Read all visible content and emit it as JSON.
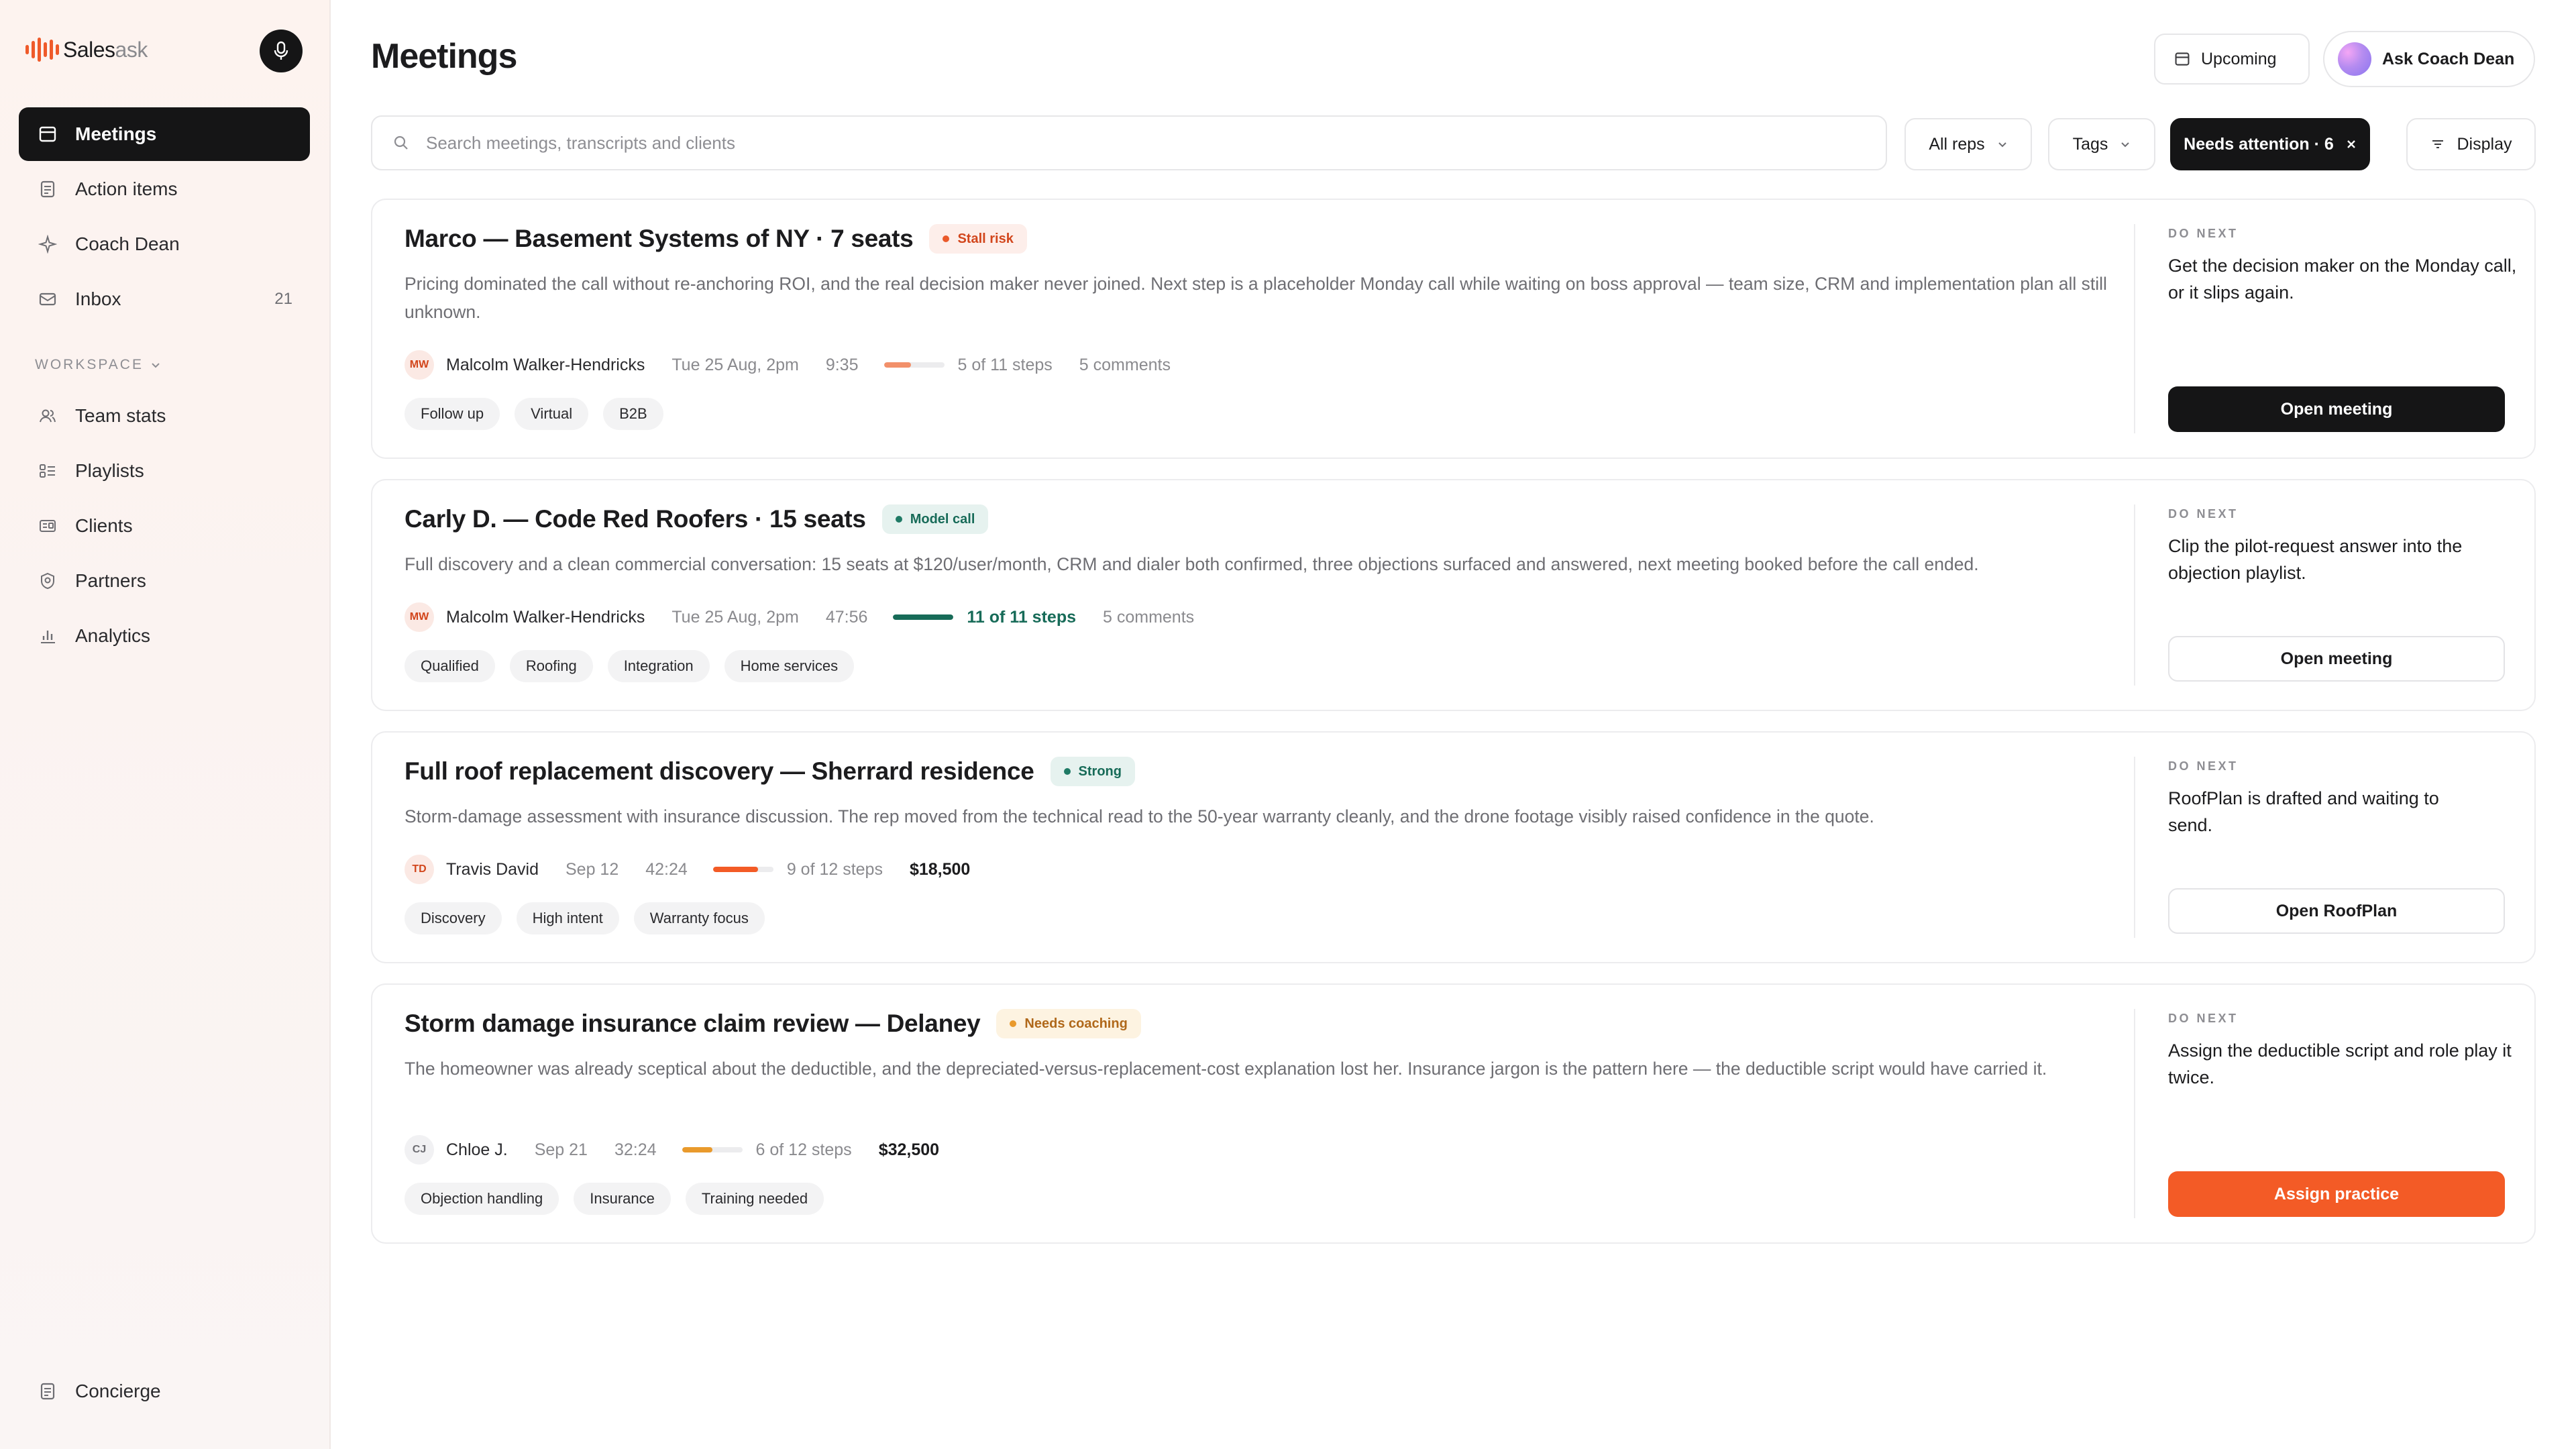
{
  "brand": {
    "name_part1": "Sales",
    "name_part2": "ask"
  },
  "sidebar": {
    "items": [
      {
        "label": "Meetings",
        "icon": "calendar-icon",
        "active": true
      },
      {
        "label": "Action items",
        "icon": "checklist-icon"
      },
      {
        "label": "Coach Dean",
        "icon": "sparkle-icon"
      },
      {
        "label": "Inbox",
        "icon": "mail-icon",
        "count": "21"
      }
    ],
    "workspace_label": "WORKSPACE",
    "workspace_items": [
      {
        "label": "Team stats",
        "icon": "users-icon"
      },
      {
        "label": "Playlists",
        "icon": "playlist-icon"
      },
      {
        "label": "Clients",
        "icon": "id-card-icon"
      },
      {
        "label": "Partners",
        "icon": "badge-icon"
      },
      {
        "label": "Analytics",
        "icon": "bar-chart-icon"
      }
    ],
    "concierge": {
      "label": "Concierge",
      "icon": "document-icon"
    }
  },
  "header": {
    "title": "Meetings",
    "upcoming_label": "Upcoming",
    "coach_label": "Ask Coach Dean"
  },
  "filters": {
    "search_placeholder": "Search meetings, transcripts and clients",
    "search_value": "",
    "all_reps": "All reps",
    "tags": "Tags",
    "needs_attention": "Needs attention · 6",
    "display": "Display"
  },
  "do_next_label": "DO NEXT",
  "meetings": [
    {
      "title": "Marco — Basement Systems of NY · 7 seats",
      "badge": "Stall risk",
      "description": "Pricing dominated the call without re-anchoring ROI, and the real decision maker never joined. Next step is a placeholder Monday call while waiting on boss approval — team size, CRM and implementation plan all still unknown.",
      "initials": "MW",
      "rep": "Malcolm Walker-Hendricks",
      "date": "Tue 25 Aug, 2pm",
      "duration": "9:35",
      "progress": 0.45,
      "progress_color": "#f2906a",
      "steps": "5 of 11 steps",
      "comments": "5 comments",
      "amount": "",
      "tags": [
        "Follow up",
        "Virtual",
        "B2B"
      ],
      "do_next": "Get the decision maker on the Monday call, or it slips again.",
      "action": "Open meeting"
    },
    {
      "title": "Carly D. — Code Red Roofers · 15 seats",
      "badge": "Model call",
      "description": "Full discovery and a clean commercial conversation: 15 seats at $120/user/month, CRM and dialer both confirmed, three objections surfaced and answered, next meeting booked before the call ended.",
      "initials": "MW",
      "rep": "Malcolm Walker-Hendricks",
      "date": "Tue 25 Aug, 2pm",
      "duration": "47:56",
      "progress": 1.0,
      "progress_color": "#176b58",
      "steps": "11 of 11 steps",
      "comments": "5 comments",
      "amount": "",
      "tags": [
        "Qualified",
        "Roofing",
        "Integration",
        "Home services"
      ],
      "do_next": "Clip the pilot-request answer into the objection playlist.",
      "action": "Open meeting"
    },
    {
      "title": "Full roof replacement discovery — Sherrard residence",
      "badge": "Strong",
      "description": "Storm-damage assessment with insurance discussion. The rep moved from the technical read to the 50-year warranty cleanly, and the drone footage visibly raised confidence in the quote.",
      "initials": "TD",
      "rep": "Travis David",
      "date": "Sep 12",
      "duration": "42:24",
      "progress": 0.75,
      "progress_color": "#f35b26",
      "steps": "9 of 12 steps",
      "comments": "",
      "amount": "$18,500",
      "tags": [
        "Discovery",
        "High intent",
        "Warranty focus"
      ],
      "do_next": "RoofPlan is drafted and waiting to send.",
      "action": "Open RoofPlan"
    },
    {
      "title": "Storm damage insurance claim review — Delaney",
      "badge": "Needs coaching",
      "description": "The homeowner was already sceptical about the deductible, and the depreciated-versus-replacement-cost explanation lost her. Insurance jargon is the pattern here — the deductible script would have carried it.",
      "initials": "CJ",
      "rep": "Chloe J.",
      "date": "Sep 21",
      "duration": "32:24",
      "progress": 0.5,
      "progress_color": "#e99a2c",
      "steps": "6 of 12 steps",
      "comments": "",
      "amount": "$32,500",
      "tags": [
        "Objection handling",
        "Insurance",
        "Training needed"
      ],
      "do_next": "Assign the deductible script and role play it twice.",
      "action": "Assign practice"
    }
  ]
}
